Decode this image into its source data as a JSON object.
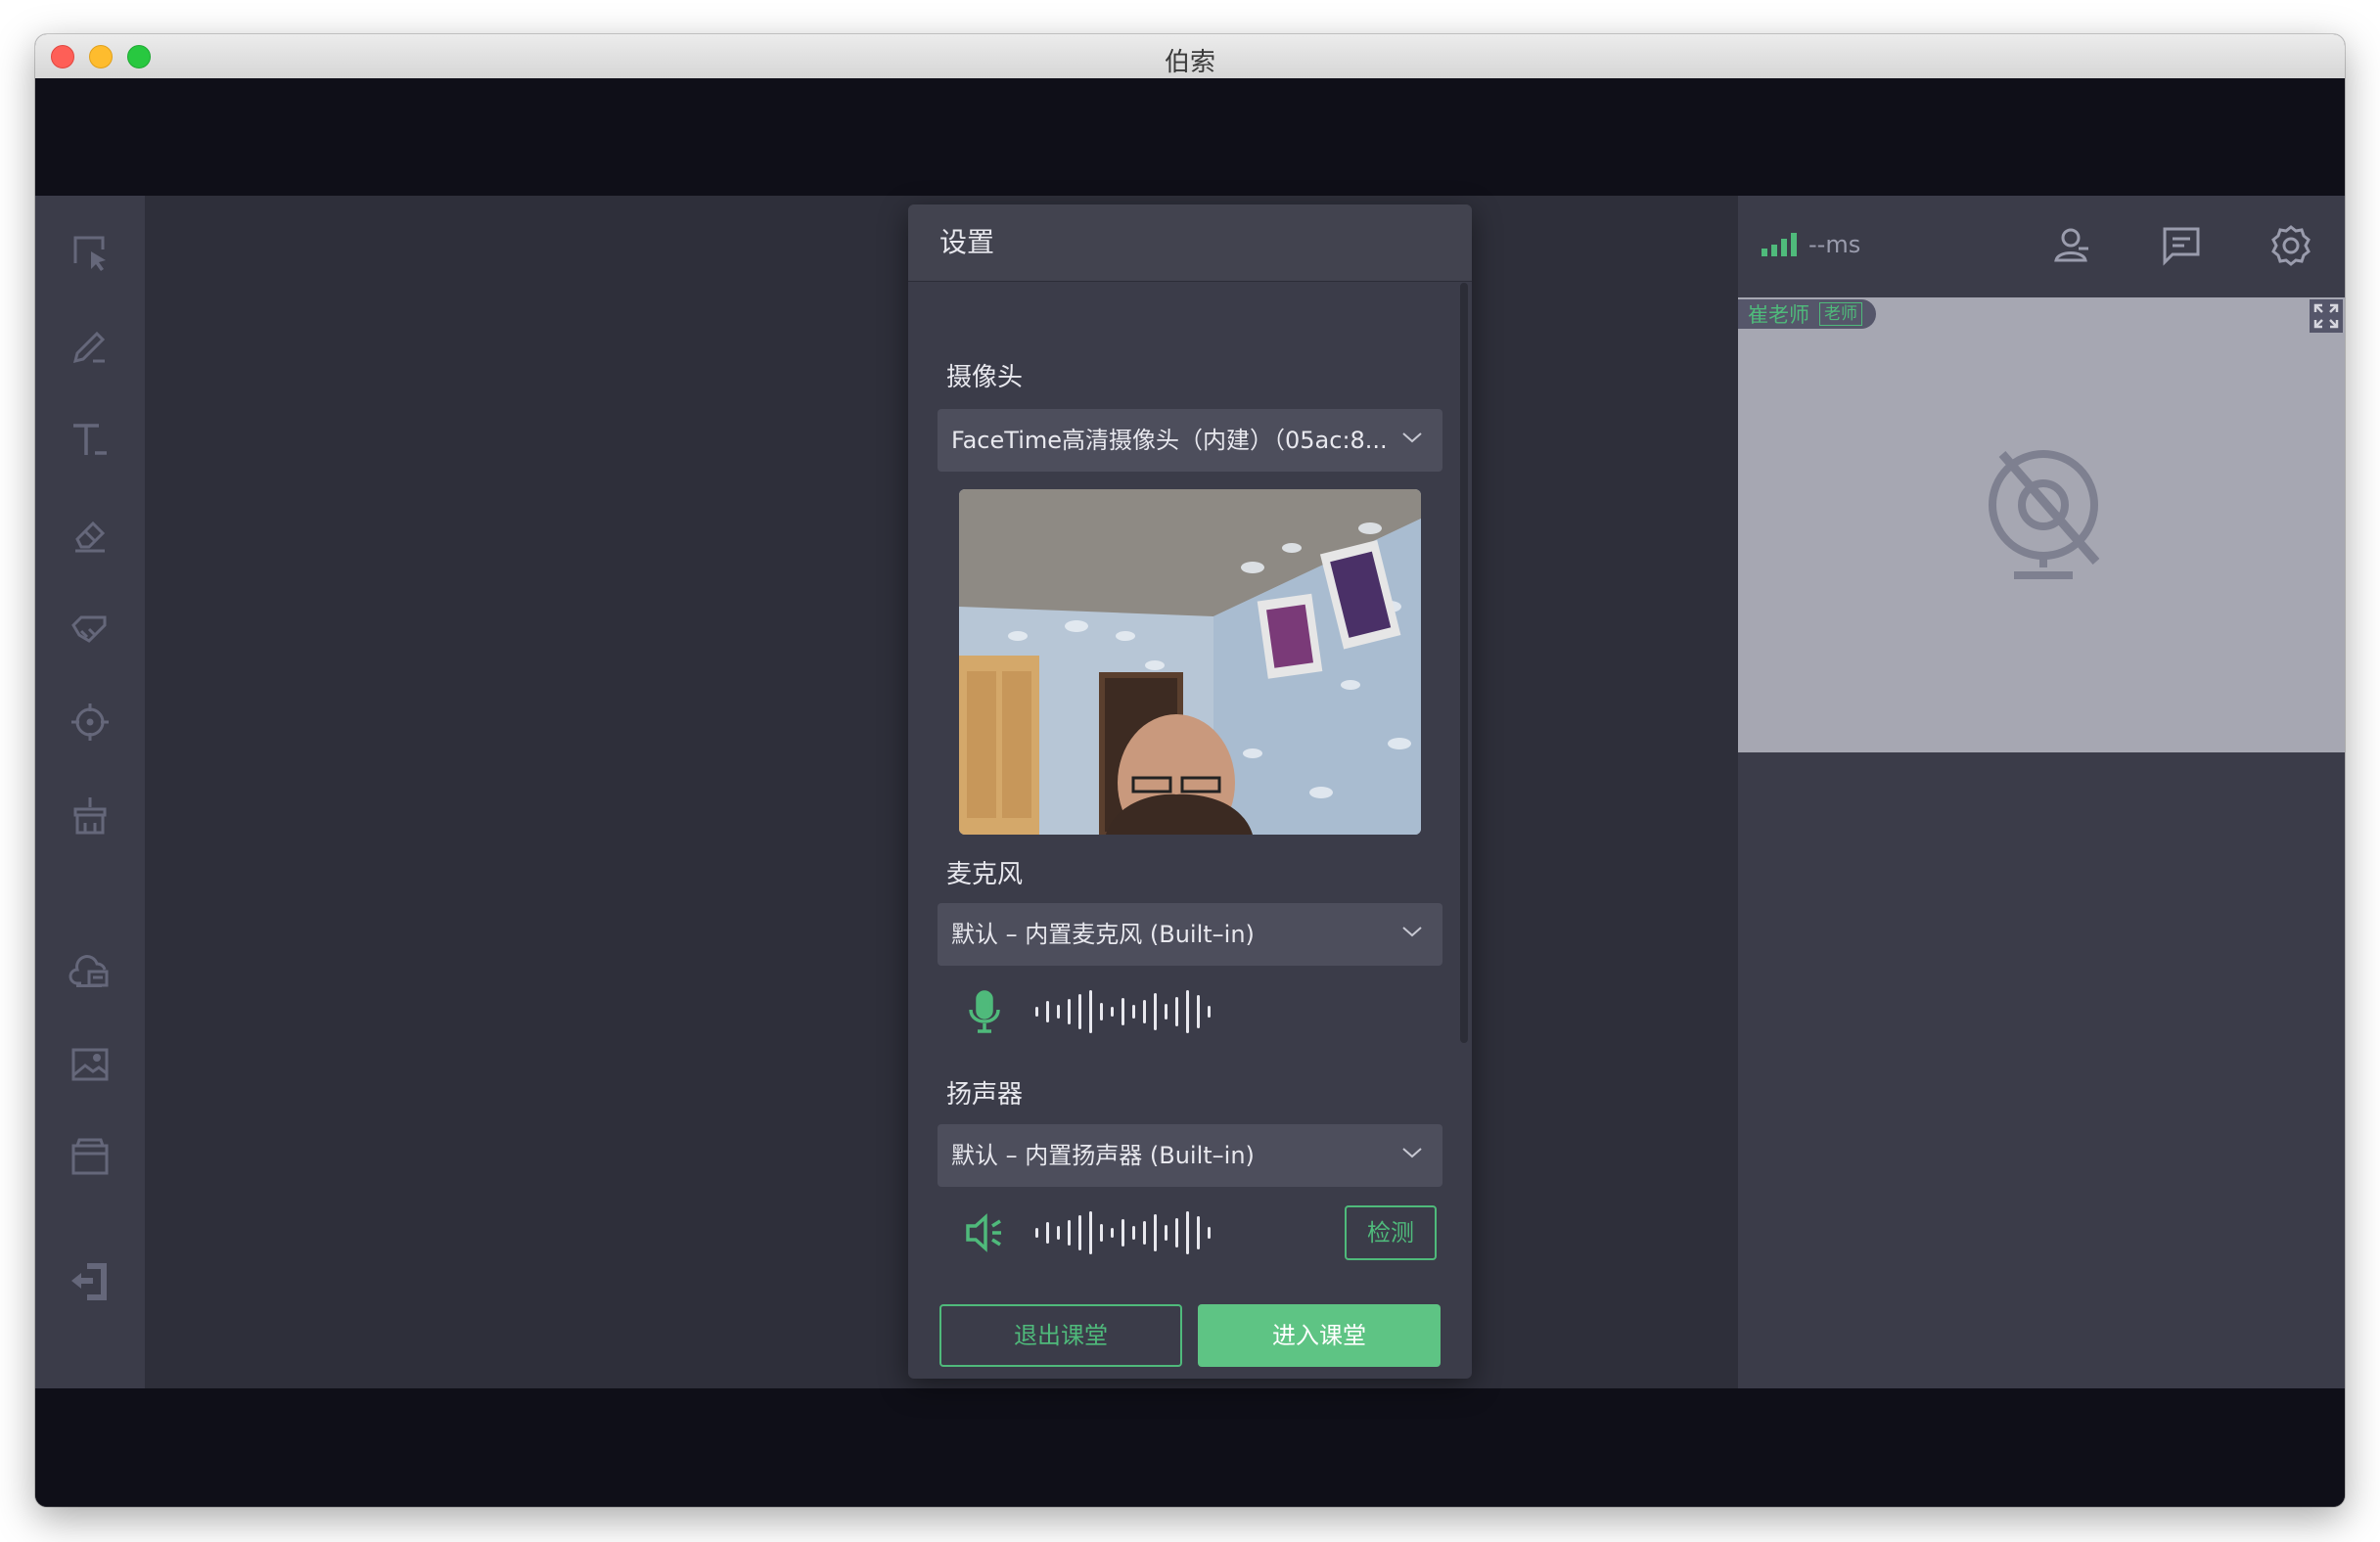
{
  "window": {
    "title": "伯索"
  },
  "toolbar": {
    "tools": [
      {
        "icon": "select-icon"
      },
      {
        "icon": "pen-icon"
      },
      {
        "icon": "text-icon"
      },
      {
        "icon": "eraser-icon"
      },
      {
        "icon": "highlighter-icon"
      },
      {
        "icon": "laser-pointer-icon"
      },
      {
        "icon": "clear-brush-icon"
      },
      {
        "icon": "cloud-courseware-icon"
      },
      {
        "icon": "image-icon"
      },
      {
        "icon": "box-icon"
      },
      {
        "icon": "exit-icon"
      }
    ]
  },
  "status": {
    "latency": "--ms"
  },
  "right_panel": {
    "icons": [
      "user-icon",
      "chat-icon",
      "gear-icon"
    ],
    "video": {
      "name": "崔老师",
      "role": "老师",
      "state_icon": "camera-off-icon"
    }
  },
  "dialog": {
    "title": "设置",
    "camera": {
      "label": "摄像头",
      "selected": "FaceTime高清摄像头（内建）（05ac:8..."
    },
    "microphone": {
      "label": "麦克风",
      "selected": "默认 – 内置麦克风 (Built–in)"
    },
    "speaker": {
      "label": "扬声器",
      "selected": "默认 – 内置扬声器 (Built–in)",
      "detect_button": "检测"
    },
    "buttons": {
      "exit": "退出课堂",
      "enter": "进入课堂"
    }
  },
  "colors": {
    "accent": "#4fba7b",
    "accent_fill": "#5ec484",
    "panel": "#3b3c49",
    "stage": "#2e2f3a",
    "chrome": "#0f0f18"
  }
}
